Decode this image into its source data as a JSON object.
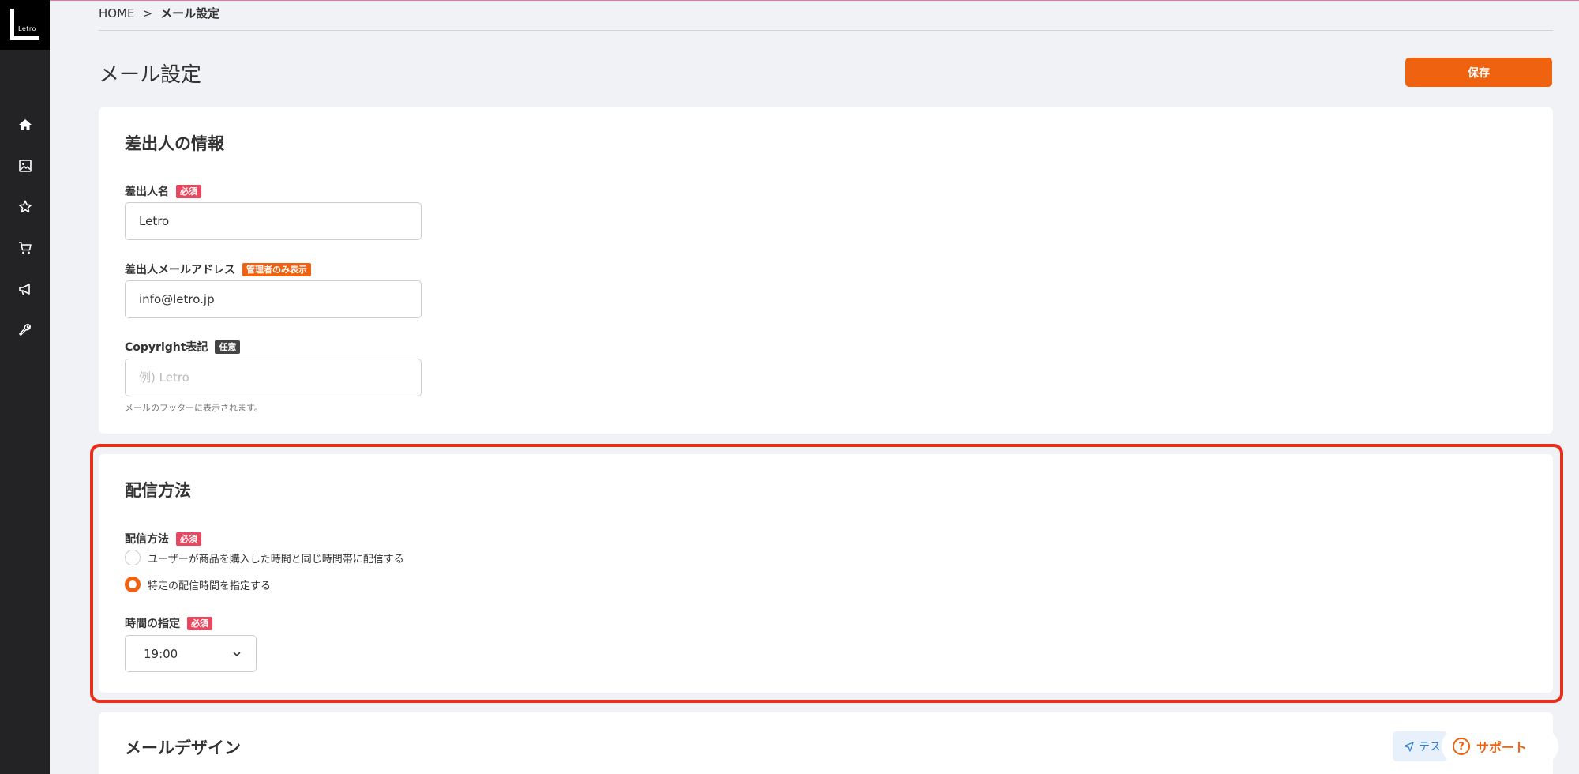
{
  "brand": {
    "logo_text": "Letro"
  },
  "sidebar": {
    "icons": [
      "home-icon",
      "image-icon",
      "star-icon",
      "cart-icon",
      "megaphone-icon",
      "wrench-icon"
    ]
  },
  "breadcrumb": {
    "home": "HOME",
    "separator": ">",
    "current": "メール設定"
  },
  "page": {
    "title": "メール設定",
    "save_label": "保存"
  },
  "sender_section": {
    "title": "差出人の情報",
    "name": {
      "label": "差出人名",
      "badge": "必須",
      "value": "Letro"
    },
    "email": {
      "label": "差出人メールアドレス",
      "badge": "管理者のみ表示",
      "value": "info@letro.jp"
    },
    "copyright": {
      "label": "Copyright表記",
      "badge": "任意",
      "placeholder": "例) Letro",
      "hint": "メールのフッターに表示されます。"
    }
  },
  "delivery_section": {
    "title": "配信方法",
    "method": {
      "label": "配信方法",
      "badge": "必須",
      "options": [
        {
          "label": "ユーザーが商品を購入した時間と同じ時間帯に配信する",
          "checked": false
        },
        {
          "label": "特定の配信時間を指定する",
          "checked": true
        }
      ]
    },
    "time": {
      "label": "時間の指定",
      "badge": "必須",
      "value": "19:00"
    }
  },
  "design_section": {
    "title": "メールデザイン",
    "test_label": "テス"
  },
  "support": {
    "label": "サポート",
    "icon_glyph": "?"
  },
  "colors": {
    "accent": "#ee6210",
    "required_badge": "#e8475f",
    "highlight": "#ea2e1c",
    "sidebar": "#232325"
  }
}
